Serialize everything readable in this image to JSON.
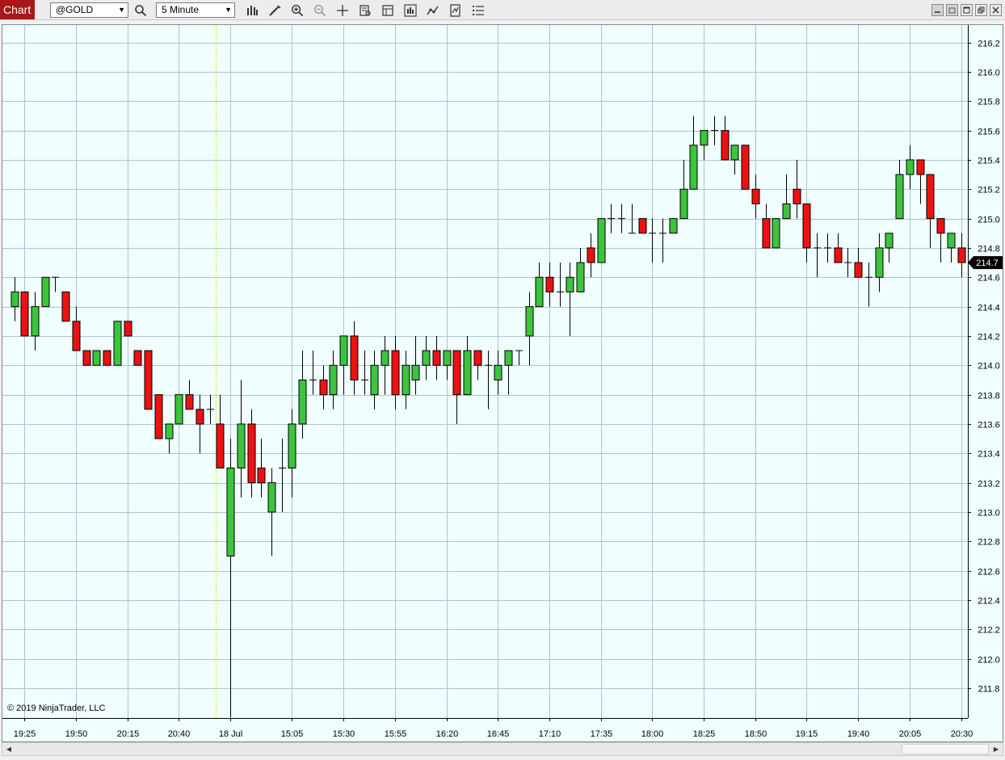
{
  "toolbar": {
    "tab_label": "Chart",
    "instrument": "@GOLD",
    "interval": "5 Minute",
    "icons": [
      "search-icon",
      "bar-type-icon",
      "draw-icon",
      "zoom-in-icon",
      "zoom-out-icon",
      "crosshair-icon",
      "data-box-icon",
      "properties-icon",
      "indicators-icon",
      "strategies-icon",
      "templates-icon",
      "menu-icon"
    ]
  },
  "window_controls": [
    "minimize-icon",
    "restore-icon",
    "maximize-icon",
    "close-icon"
  ],
  "copyright": "© 2019 NinjaTrader, LLC",
  "colors": {
    "background": "#f0feff",
    "grid": "#a8c4d4",
    "up": "#3cc43c",
    "down": "#ee1111",
    "session_break": "#e8e000",
    "price_marker": "#000000"
  },
  "chart_data": {
    "type": "candlestick",
    "title": "",
    "xlabel": "",
    "ylabel": "",
    "ylim": [
      211.6,
      216.3
    ],
    "y_ticks": [
      211.8,
      212.0,
      212.2,
      212.4,
      212.6,
      212.8,
      213.0,
      213.2,
      213.4,
      213.6,
      213.8,
      214.0,
      214.2,
      214.4,
      214.6,
      214.8,
      215.0,
      215.2,
      215.4,
      215.6,
      215.8,
      216.0,
      216.2
    ],
    "x_tick_labels": [
      {
        "bar": 1,
        "label": "19:25"
      },
      {
        "bar": 6,
        "label": "19:50"
      },
      {
        "bar": 11,
        "label": "20:15"
      },
      {
        "bar": 16,
        "label": "20:40"
      },
      {
        "bar": 21,
        "label": "18 Jul"
      },
      {
        "bar": 27,
        "label": "15:05"
      },
      {
        "bar": 32,
        "label": "15:30"
      },
      {
        "bar": 37,
        "label": "15:55"
      },
      {
        "bar": 42,
        "label": "16:20"
      },
      {
        "bar": 47,
        "label": "16:45"
      },
      {
        "bar": 52,
        "label": "17:10"
      },
      {
        "bar": 57,
        "label": "17:35"
      },
      {
        "bar": 62,
        "label": "18:00"
      },
      {
        "bar": 67,
        "label": "18:25"
      },
      {
        "bar": 72,
        "label": "18:50"
      },
      {
        "bar": 77,
        "label": "19:15"
      },
      {
        "bar": 82,
        "label": "19:40"
      },
      {
        "bar": 87,
        "label": "20:05"
      },
      {
        "bar": 92,
        "label": "20:30"
      }
    ],
    "session_break_after_bar": 20,
    "last_price": "214.7",
    "last_price_value": 214.7,
    "candles": [
      {
        "o": 214.4,
        "h": 214.6,
        "l": 214.3,
        "c": 214.5
      },
      {
        "o": 214.5,
        "h": 214.5,
        "l": 214.2,
        "c": 214.2
      },
      {
        "o": 214.2,
        "h": 214.5,
        "l": 214.1,
        "c": 214.4
      },
      {
        "o": 214.4,
        "h": 214.6,
        "l": 214.4,
        "c": 214.6
      },
      {
        "o": 214.6,
        "h": 214.6,
        "l": 214.5,
        "c": 214.6
      },
      {
        "o": 214.5,
        "h": 214.5,
        "l": 214.3,
        "c": 214.3
      },
      {
        "o": 214.3,
        "h": 214.4,
        "l": 214.1,
        "c": 214.1
      },
      {
        "o": 214.1,
        "h": 214.1,
        "l": 214.0,
        "c": 214.0
      },
      {
        "o": 214.0,
        "h": 214.1,
        "l": 214.0,
        "c": 214.1
      },
      {
        "o": 214.1,
        "h": 214.1,
        "l": 214.0,
        "c": 214.0
      },
      {
        "o": 214.0,
        "h": 214.3,
        "l": 214.0,
        "c": 214.3
      },
      {
        "o": 214.3,
        "h": 214.3,
        "l": 214.2,
        "c": 214.2
      },
      {
        "o": 214.1,
        "h": 214.1,
        "l": 214.0,
        "c": 214.0
      },
      {
        "o": 214.1,
        "h": 214.1,
        "l": 213.7,
        "c": 213.7
      },
      {
        "o": 213.8,
        "h": 213.8,
        "l": 213.5,
        "c": 213.5
      },
      {
        "o": 213.5,
        "h": 213.6,
        "l": 213.4,
        "c": 213.6
      },
      {
        "o": 213.6,
        "h": 213.8,
        "l": 213.6,
        "c": 213.8
      },
      {
        "o": 213.8,
        "h": 213.9,
        "l": 213.7,
        "c": 213.7
      },
      {
        "o": 213.7,
        "h": 213.8,
        "l": 213.4,
        "c": 213.6
      },
      {
        "o": 213.7,
        "h": 213.8,
        "l": 213.6,
        "c": 213.7
      },
      {
        "o": 213.6,
        "h": 213.8,
        "l": 213.3,
        "c": 213.3
      },
      {
        "o": 212.7,
        "h": 213.5,
        "l": 211.6,
        "c": 213.3
      },
      {
        "o": 213.3,
        "h": 213.9,
        "l": 213.1,
        "c": 213.6
      },
      {
        "o": 213.6,
        "h": 213.7,
        "l": 213.1,
        "c": 213.2
      },
      {
        "o": 213.3,
        "h": 213.5,
        "l": 213.1,
        "c": 213.2
      },
      {
        "o": 213.0,
        "h": 213.3,
        "l": 212.7,
        "c": 213.2
      },
      {
        "o": 213.3,
        "h": 213.5,
        "l": 213.0,
        "c": 213.3
      },
      {
        "o": 213.3,
        "h": 213.7,
        "l": 213.1,
        "c": 213.6
      },
      {
        "o": 213.6,
        "h": 214.1,
        "l": 213.5,
        "c": 213.9
      },
      {
        "o": 213.9,
        "h": 214.1,
        "l": 213.8,
        "c": 213.9
      },
      {
        "o": 213.9,
        "h": 214.0,
        "l": 213.7,
        "c": 213.8
      },
      {
        "o": 213.8,
        "h": 214.1,
        "l": 213.7,
        "c": 214.0
      },
      {
        "o": 214.0,
        "h": 214.2,
        "l": 213.8,
        "c": 214.2
      },
      {
        "o": 214.2,
        "h": 214.3,
        "l": 213.8,
        "c": 213.9
      },
      {
        "o": 213.9,
        "h": 214.1,
        "l": 213.8,
        "c": 213.9
      },
      {
        "o": 213.8,
        "h": 214.1,
        "l": 213.7,
        "c": 214.0
      },
      {
        "o": 214.0,
        "h": 214.2,
        "l": 213.8,
        "c": 214.1
      },
      {
        "o": 214.1,
        "h": 214.2,
        "l": 213.7,
        "c": 213.8
      },
      {
        "o": 213.8,
        "h": 214.1,
        "l": 213.7,
        "c": 214.0
      },
      {
        "o": 213.9,
        "h": 214.2,
        "l": 213.8,
        "c": 214.0
      },
      {
        "o": 214.0,
        "h": 214.2,
        "l": 213.9,
        "c": 214.1
      },
      {
        "o": 214.1,
        "h": 214.2,
        "l": 213.9,
        "c": 214.0
      },
      {
        "o": 214.0,
        "h": 214.1,
        "l": 213.9,
        "c": 214.1
      },
      {
        "o": 214.1,
        "h": 214.1,
        "l": 213.6,
        "c": 213.8
      },
      {
        "o": 213.8,
        "h": 214.2,
        "l": 213.8,
        "c": 214.1
      },
      {
        "o": 214.1,
        "h": 214.1,
        "l": 213.9,
        "c": 214.0
      },
      {
        "o": 214.0,
        "h": 214.1,
        "l": 213.7,
        "c": 214.0
      },
      {
        "o": 213.9,
        "h": 214.1,
        "l": 213.8,
        "c": 214.0
      },
      {
        "o": 214.0,
        "h": 214.1,
        "l": 213.8,
        "c": 214.1
      },
      {
        "o": 214.1,
        "h": 214.1,
        "l": 214.0,
        "c": 214.1
      },
      {
        "o": 214.2,
        "h": 214.5,
        "l": 214.0,
        "c": 214.4
      },
      {
        "o": 214.4,
        "h": 214.7,
        "l": 214.4,
        "c": 214.6
      },
      {
        "o": 214.6,
        "h": 214.7,
        "l": 214.4,
        "c": 214.5
      },
      {
        "o": 214.5,
        "h": 214.7,
        "l": 214.4,
        "c": 214.5
      },
      {
        "o": 214.5,
        "h": 214.7,
        "l": 214.2,
        "c": 214.6
      },
      {
        "o": 214.5,
        "h": 214.8,
        "l": 214.5,
        "c": 214.7
      },
      {
        "o": 214.8,
        "h": 214.9,
        "l": 214.6,
        "c": 214.7
      },
      {
        "o": 214.7,
        "h": 215.0,
        "l": 214.7,
        "c": 215.0
      },
      {
        "o": 215.0,
        "h": 215.1,
        "l": 214.9,
        "c": 215.0
      },
      {
        "o": 215.0,
        "h": 215.1,
        "l": 214.9,
        "c": 215.0
      },
      {
        "o": 214.9,
        "h": 215.1,
        "l": 214.9,
        "c": 214.9
      },
      {
        "o": 215.0,
        "h": 215.0,
        "l": 214.9,
        "c": 214.9
      },
      {
        "o": 214.9,
        "h": 215.0,
        "l": 214.7,
        "c": 214.9
      },
      {
        "o": 214.9,
        "h": 215.0,
        "l": 214.7,
        "c": 214.9
      },
      {
        "o": 214.9,
        "h": 215.0,
        "l": 214.9,
        "c": 215.0
      },
      {
        "o": 215.0,
        "h": 215.4,
        "l": 215.0,
        "c": 215.2
      },
      {
        "o": 215.2,
        "h": 215.7,
        "l": 215.2,
        "c": 215.5
      },
      {
        "o": 215.5,
        "h": 215.6,
        "l": 215.4,
        "c": 215.6
      },
      {
        "o": 215.6,
        "h": 215.7,
        "l": 215.5,
        "c": 215.6
      },
      {
        "o": 215.6,
        "h": 215.7,
        "l": 215.4,
        "c": 215.4
      },
      {
        "o": 215.4,
        "h": 215.5,
        "l": 215.3,
        "c": 215.5
      },
      {
        "o": 215.5,
        "h": 215.5,
        "l": 215.2,
        "c": 215.2
      },
      {
        "o": 215.2,
        "h": 215.3,
        "l": 215.0,
        "c": 215.1
      },
      {
        "o": 215.0,
        "h": 215.1,
        "l": 214.8,
        "c": 214.8
      },
      {
        "o": 214.8,
        "h": 215.0,
        "l": 214.8,
        "c": 215.0
      },
      {
        "o": 215.0,
        "h": 215.3,
        "l": 215.0,
        "c": 215.1
      },
      {
        "o": 215.2,
        "h": 215.4,
        "l": 215.0,
        "c": 215.1
      },
      {
        "o": 215.1,
        "h": 215.1,
        "l": 214.7,
        "c": 214.8
      },
      {
        "o": 214.8,
        "h": 214.9,
        "l": 214.6,
        "c": 214.8
      },
      {
        "o": 214.8,
        "h": 214.9,
        "l": 214.7,
        "c": 214.8
      },
      {
        "o": 214.8,
        "h": 214.9,
        "l": 214.7,
        "c": 214.7
      },
      {
        "o": 214.7,
        "h": 214.8,
        "l": 214.6,
        "c": 214.7
      },
      {
        "o": 214.7,
        "h": 214.8,
        "l": 214.6,
        "c": 214.6
      },
      {
        "o": 214.6,
        "h": 214.7,
        "l": 214.4,
        "c": 214.6
      },
      {
        "o": 214.6,
        "h": 214.9,
        "l": 214.5,
        "c": 214.8
      },
      {
        "o": 214.8,
        "h": 214.9,
        "l": 214.7,
        "c": 214.9
      },
      {
        "o": 215.0,
        "h": 215.4,
        "l": 215.0,
        "c": 215.3
      },
      {
        "o": 215.3,
        "h": 215.5,
        "l": 215.2,
        "c": 215.4
      },
      {
        "o": 215.4,
        "h": 215.4,
        "l": 215.1,
        "c": 215.3
      },
      {
        "o": 215.3,
        "h": 215.3,
        "l": 214.8,
        "c": 215.0
      },
      {
        "o": 215.0,
        "h": 215.0,
        "l": 214.7,
        "c": 214.9
      },
      {
        "o": 214.8,
        "h": 214.9,
        "l": 214.7,
        "c": 214.9
      },
      {
        "o": 214.8,
        "h": 214.9,
        "l": 214.6,
        "c": 214.7
      }
    ]
  }
}
